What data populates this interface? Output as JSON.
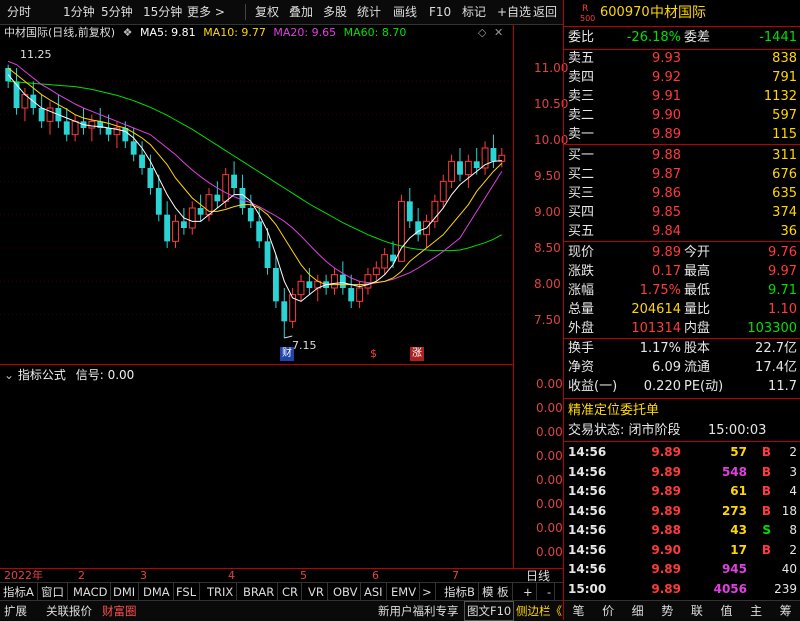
{
  "toolbar": {
    "items": [
      "分时",
      "1分钟",
      "5分钟",
      "15分钟",
      "更多 >",
      "复权",
      "叠加",
      "多股",
      "统计",
      "画线",
      "F10",
      "标记",
      "+自选",
      "返回"
    ]
  },
  "chart_header": {
    "title": "中材国际(日线,前复权)",
    "ma5": "MA5: 9.81",
    "ma10": "MA10: 9.77",
    "ma20": "MA20: 9.65",
    "ma60": "MA60: 8.70",
    "ma5_color": "#ffffff",
    "ma10_color": "#ffd700",
    "ma20_color": "#e040e0",
    "ma60_color": "#00e000"
  },
  "annotations": {
    "high_label": "11.25",
    "low_label": "7.15",
    "badge1": "财",
    "badge2": "$",
    "badge3": "涨"
  },
  "price_axis": [
    "11.00",
    "10.50",
    "10.00",
    "9.50",
    "9.00",
    "8.50",
    "8.00",
    "7.50"
  ],
  "indicator": {
    "title": "指标公式",
    "signal": "信号: 0.00",
    "axis": [
      "0.00",
      "0.00",
      "0.00",
      "0.00",
      "0.00",
      "0.00",
      "0.00",
      "0.00"
    ]
  },
  "x_axis": [
    "2022年",
    "2",
    "3",
    "4",
    "5",
    "6",
    "7"
  ],
  "x_axis_right": "日线",
  "tabs": [
    "指标A",
    "窗口",
    "MACD",
    "DMI",
    "DMA",
    "FSL",
    "TRIX",
    "BRAR",
    "CR",
    "VR",
    "OBV",
    "ASI",
    "EMV",
    ">",
    "指标B",
    "模 板",
    "+",
    "-"
  ],
  "bottom_bar": {
    "left": [
      "扩展",
      "关联报价",
      "财富圈"
    ],
    "right": [
      "新用户福利专享",
      "图文F10",
      "侧边栏《"
    ]
  },
  "quote": {
    "code": "600970",
    "name": "中材国际",
    "r_badge": "R",
    "r_sub": "500",
    "weibi_label": "委比",
    "weibi": "-26.18%",
    "weicha_label": "委差",
    "weicha": "-1441",
    "asks": [
      {
        "label": "卖五",
        "price": "9.93",
        "vol": "838"
      },
      {
        "label": "卖四",
        "price": "9.92",
        "vol": "791"
      },
      {
        "label": "卖三",
        "price": "9.91",
        "vol": "1132"
      },
      {
        "label": "卖二",
        "price": "9.90",
        "vol": "597"
      },
      {
        "label": "卖一",
        "price": "9.89",
        "vol": "115"
      }
    ],
    "bids": [
      {
        "label": "买一",
        "price": "9.88",
        "vol": "311"
      },
      {
        "label": "买二",
        "price": "9.87",
        "vol": "676"
      },
      {
        "label": "买三",
        "price": "9.86",
        "vol": "635"
      },
      {
        "label": "买四",
        "price": "9.85",
        "vol": "374"
      },
      {
        "label": "买五",
        "price": "9.84",
        "vol": "36"
      }
    ],
    "stats": [
      {
        "l1": "现价",
        "v1": "9.89",
        "l2": "今开",
        "v2": "9.76",
        "c1": "red",
        "c2": "red"
      },
      {
        "l1": "涨跌",
        "v1": "0.17",
        "l2": "最高",
        "v2": "9.97",
        "c1": "red",
        "c2": "red"
      },
      {
        "l1": "涨幅",
        "v1": "1.75%",
        "l2": "最低",
        "v2": "9.71",
        "c1": "red",
        "c2": "green"
      },
      {
        "l1": "总量",
        "v1": "204614",
        "l2": "量比",
        "v2": "1.10",
        "c1": "yellow",
        "c2": "red"
      },
      {
        "l1": "外盘",
        "v1": "101314",
        "l2": "内盘",
        "v2": "103300",
        "c1": "red",
        "c2": "green"
      }
    ],
    "stats2": [
      {
        "l1": "换手",
        "v1": "1.17%",
        "l2": "股本",
        "v2": "22.7亿"
      },
      {
        "l1": "净资",
        "v1": "6.09",
        "l2": "流通",
        "v2": "17.4亿"
      },
      {
        "l1": "收益(一)",
        "v1": "0.220",
        "l2": "PE(动)",
        "v2": "11.7"
      }
    ],
    "precise_label": "精准定位委托单",
    "status_label": "交易状态: 闭市阶段",
    "status_time": "15:00:03",
    "ticks": [
      {
        "time": "14:56",
        "price": "9.89",
        "vol": "57",
        "side": "B",
        "n": "2",
        "pc": "red",
        "vc": "yellow",
        "sc": "red"
      },
      {
        "time": "14:56",
        "price": "9.89",
        "vol": "548",
        "side": "B",
        "n": "3",
        "pc": "red",
        "vc": "magenta",
        "sc": "red"
      },
      {
        "time": "14:56",
        "price": "9.89",
        "vol": "61",
        "side": "B",
        "n": "4",
        "pc": "red",
        "vc": "yellow",
        "sc": "red"
      },
      {
        "time": "14:56",
        "price": "9.89",
        "vol": "273",
        "side": "B",
        "n": "18",
        "pc": "red",
        "vc": "yellow",
        "sc": "red"
      },
      {
        "time": "14:56",
        "price": "9.88",
        "vol": "43",
        "side": "S",
        "n": "8",
        "pc": "red",
        "vc": "yellow",
        "sc": "green"
      },
      {
        "time": "14:56",
        "price": "9.90",
        "vol": "17",
        "side": "B",
        "n": "2",
        "pc": "red",
        "vc": "yellow",
        "sc": "red"
      },
      {
        "time": "14:56",
        "price": "9.89",
        "vol": "945",
        "side": "",
        "n": "40",
        "pc": "red",
        "vc": "magenta",
        "sc": "red"
      },
      {
        "time": "15:00",
        "price": "9.89",
        "vol": "4056",
        "side": "",
        "n": "239",
        "pc": "red",
        "vc": "magenta",
        "sc": "red"
      }
    ],
    "bottom_tabs": [
      "笔",
      "价",
      "细",
      "势",
      "联",
      "值",
      "主",
      "筹"
    ]
  },
  "chart_data": {
    "type": "candlestick",
    "ylim": [
      7.0,
      11.5
    ],
    "candles": [
      [
        11.2,
        11.25,
        10.9,
        11.0
      ],
      [
        11.0,
        11.2,
        10.5,
        10.6
      ],
      [
        10.6,
        10.9,
        10.4,
        10.8
      ],
      [
        10.8,
        11.0,
        10.5,
        10.6
      ],
      [
        10.6,
        10.8,
        10.3,
        10.4
      ],
      [
        10.4,
        10.7,
        10.2,
        10.6
      ],
      [
        10.6,
        10.8,
        10.3,
        10.4
      ],
      [
        10.4,
        10.6,
        10.1,
        10.2
      ],
      [
        10.2,
        10.5,
        10.1,
        10.4
      ],
      [
        10.4,
        10.6,
        10.2,
        10.3
      ],
      [
        10.3,
        10.5,
        10.1,
        10.4
      ],
      [
        10.4,
        10.6,
        10.2,
        10.3
      ],
      [
        10.3,
        10.5,
        10.1,
        10.2
      ],
      [
        10.2,
        10.4,
        10.0,
        10.3
      ],
      [
        10.3,
        10.4,
        10.0,
        10.1
      ],
      [
        10.1,
        10.3,
        9.8,
        9.9
      ],
      [
        9.9,
        10.1,
        9.6,
        9.7
      ],
      [
        9.7,
        9.9,
        9.3,
        9.4
      ],
      [
        9.4,
        9.6,
        8.9,
        9.0
      ],
      [
        9.0,
        9.2,
        8.5,
        8.6
      ],
      [
        8.6,
        9.0,
        8.5,
        8.9
      ],
      [
        8.9,
        9.1,
        8.7,
        8.8
      ],
      [
        8.8,
        9.2,
        8.7,
        9.1
      ],
      [
        9.1,
        9.3,
        8.9,
        9.0
      ],
      [
        9.0,
        9.4,
        8.9,
        9.3
      ],
      [
        9.3,
        9.5,
        9.1,
        9.2
      ],
      [
        9.2,
        9.7,
        9.1,
        9.6
      ],
      [
        9.6,
        9.8,
        9.3,
        9.4
      ],
      [
        9.4,
        9.6,
        9.0,
        9.1
      ],
      [
        9.1,
        9.3,
        8.8,
        8.9
      ],
      [
        8.9,
        9.1,
        8.5,
        8.6
      ],
      [
        8.6,
        8.8,
        8.1,
        8.2
      ],
      [
        8.2,
        8.4,
        7.6,
        7.7
      ],
      [
        7.7,
        7.9,
        7.15,
        7.4
      ],
      [
        7.4,
        7.9,
        7.3,
        7.8
      ],
      [
        7.8,
        8.1,
        7.7,
        8.0
      ],
      [
        8.0,
        8.2,
        7.8,
        7.9
      ],
      [
        7.9,
        8.1,
        7.7,
        8.0
      ],
      [
        8.0,
        8.1,
        7.8,
        7.9
      ],
      [
        7.9,
        8.2,
        7.8,
        8.1
      ],
      [
        8.1,
        8.3,
        7.8,
        7.9
      ],
      [
        7.9,
        8.1,
        7.6,
        7.7
      ],
      [
        7.7,
        8.0,
        7.6,
        7.9
      ],
      [
        7.9,
        8.2,
        7.8,
        8.1
      ],
      [
        8.1,
        8.3,
        8.0,
        8.2
      ],
      [
        8.2,
        8.5,
        8.1,
        8.4
      ],
      [
        8.4,
        8.6,
        8.2,
        8.3
      ],
      [
        8.3,
        9.3,
        8.3,
        9.2
      ],
      [
        9.2,
        9.4,
        8.8,
        8.9
      ],
      [
        8.9,
        9.1,
        8.6,
        8.7
      ],
      [
        8.7,
        9.0,
        8.5,
        8.9
      ],
      [
        8.9,
        9.3,
        8.8,
        9.2
      ],
      [
        9.2,
        9.6,
        9.1,
        9.5
      ],
      [
        9.5,
        9.9,
        9.4,
        9.8
      ],
      [
        9.8,
        10.0,
        9.5,
        9.6
      ],
      [
        9.6,
        9.9,
        9.4,
        9.8
      ],
      [
        9.8,
        10.0,
        9.6,
        9.7
      ],
      [
        9.7,
        10.1,
        9.6,
        10.0
      ],
      [
        10.0,
        10.2,
        9.7,
        9.8
      ],
      [
        9.8,
        10.0,
        9.71,
        9.89
      ]
    ],
    "ma5": [
      11.1,
      10.95,
      10.8,
      10.7,
      10.6,
      10.55,
      10.5,
      10.45,
      10.4,
      10.35,
      10.33,
      10.32,
      10.3,
      10.28,
      10.25,
      10.15,
      10.0,
      9.8,
      9.55,
      9.3,
      9.1,
      8.95,
      8.9,
      8.9,
      9.0,
      9.1,
      9.2,
      9.3,
      9.3,
      9.2,
      9.0,
      8.75,
      8.4,
      8.0,
      7.75,
      7.7,
      7.8,
      7.9,
      7.95,
      7.97,
      7.98,
      7.95,
      7.92,
      7.95,
      8.0,
      8.1,
      8.25,
      8.5,
      8.65,
      8.75,
      8.8,
      8.95,
      9.1,
      9.3,
      9.45,
      9.55,
      9.65,
      9.75,
      9.8,
      9.81
    ],
    "ma10": [
      11.2,
      11.1,
      11.0,
      10.9,
      10.8,
      10.72,
      10.65,
      10.58,
      10.5,
      10.45,
      10.42,
      10.4,
      10.37,
      10.33,
      10.3,
      10.23,
      10.15,
      10.05,
      9.9,
      9.75,
      9.55,
      9.4,
      9.25,
      9.15,
      9.05,
      9.05,
      9.08,
      9.12,
      9.15,
      9.15,
      9.1,
      9.0,
      8.85,
      8.65,
      8.45,
      8.25,
      8.1,
      8.0,
      7.95,
      7.95,
      7.95,
      7.95,
      7.95,
      7.96,
      7.98,
      8.0,
      8.05,
      8.15,
      8.3,
      8.4,
      8.5,
      8.6,
      8.7,
      8.85,
      9.0,
      9.15,
      9.35,
      9.5,
      9.65,
      9.77
    ],
    "ma20": [
      11.3,
      11.25,
      11.15,
      11.05,
      10.95,
      10.88,
      10.8,
      10.73,
      10.66,
      10.6,
      10.55,
      10.5,
      10.45,
      10.4,
      10.35,
      10.3,
      10.25,
      10.2,
      10.1,
      10.0,
      9.9,
      9.78,
      9.67,
      9.57,
      9.48,
      9.4,
      9.33,
      9.27,
      9.22,
      9.18,
      9.12,
      9.05,
      8.98,
      8.9,
      8.8,
      8.68,
      8.55,
      8.42,
      8.3,
      8.2,
      8.12,
      8.05,
      8.0,
      7.98,
      7.98,
      8.0,
      8.03,
      8.08,
      8.13,
      8.2,
      8.28,
      8.36,
      8.45,
      8.55,
      8.65,
      8.85,
      9.05,
      9.25,
      9.45,
      9.65
    ],
    "ma60": [
      11.0,
      10.99,
      10.98,
      10.97,
      10.96,
      10.95,
      10.94,
      10.93,
      10.92,
      10.9,
      10.88,
      10.85,
      10.82,
      10.79,
      10.75,
      10.71,
      10.66,
      10.61,
      10.55,
      10.49,
      10.42,
      10.35,
      10.28,
      10.2,
      10.12,
      10.04,
      9.96,
      9.88,
      9.8,
      9.72,
      9.64,
      9.56,
      9.48,
      9.4,
      9.32,
      9.24,
      9.16,
      9.09,
      9.02,
      8.95,
      8.88,
      8.82,
      8.76,
      8.7,
      8.65,
      8.6,
      8.56,
      8.53,
      8.5,
      8.48,
      8.47,
      8.46,
      8.46,
      8.46,
      8.47,
      8.5,
      8.54,
      8.58,
      8.63,
      8.7
    ]
  }
}
